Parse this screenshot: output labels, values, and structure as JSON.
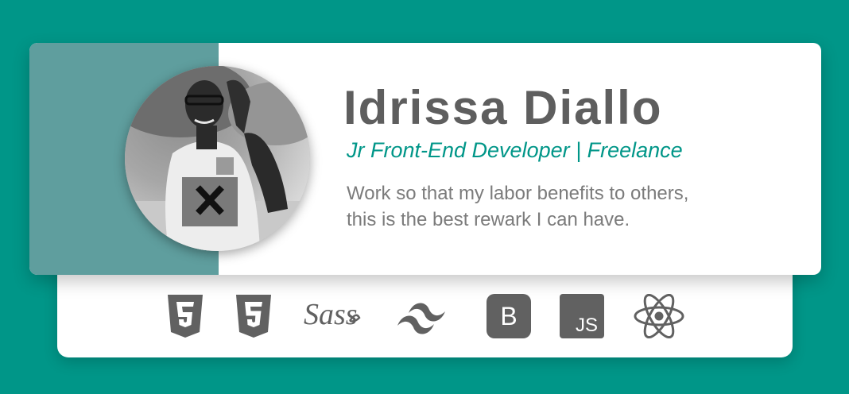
{
  "profile": {
    "name": "Idrissa Diallo",
    "role": "Jr Front-End Developer | Freelance",
    "bio_lines": [
      "Work so that my labor benefits to others,",
      "this is the best rewark I can have."
    ]
  },
  "skills": [
    {
      "icon": "html5-icon"
    },
    {
      "icon": "css3-icon"
    },
    {
      "icon": "sass-icon",
      "label": "Sass"
    },
    {
      "icon": "tailwind-icon"
    },
    {
      "icon": "bootstrap-icon",
      "label": "B"
    },
    {
      "icon": "javascript-icon",
      "label": "JS"
    },
    {
      "icon": "react-icon"
    }
  ],
  "colors": {
    "background": "#009688",
    "accent_panel": "#5f9e9e",
    "name_text": "#5e5e5e",
    "role_text": "#009688",
    "bio_text": "#7b7b7b",
    "icon_gray": "#616161"
  }
}
